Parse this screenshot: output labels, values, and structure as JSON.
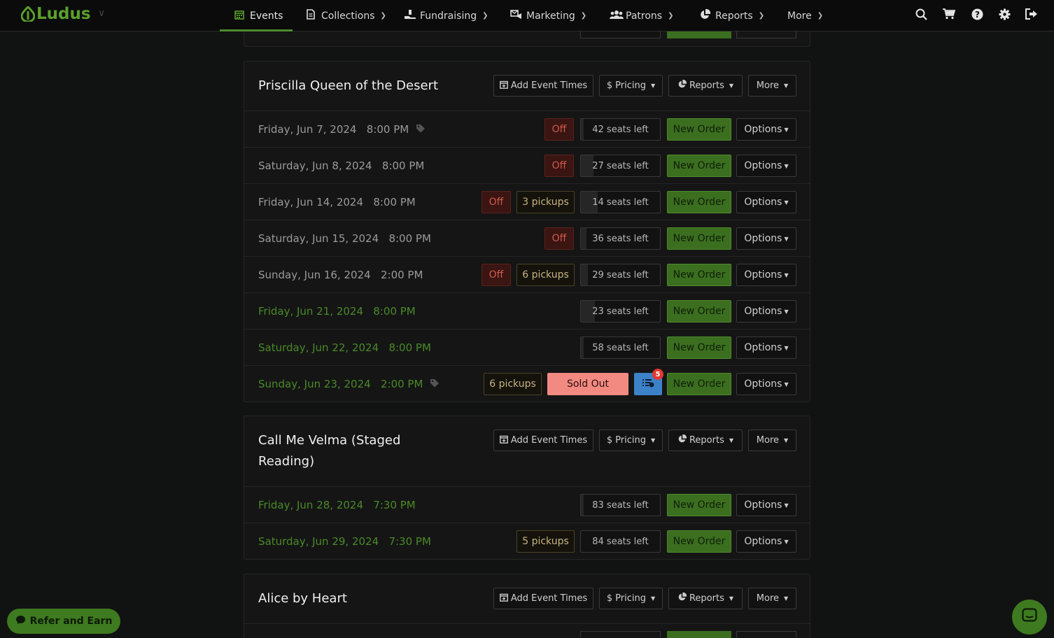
{
  "nav": {
    "logo": "Ludus",
    "items": [
      {
        "label": "Events",
        "icon": "calendar-icon"
      },
      {
        "label": "Collections",
        "icon": "document-icon"
      },
      {
        "label": "Fundraising",
        "icon": "donate-hand-icon"
      },
      {
        "label": "Marketing",
        "icon": "mail-bullhorn-icon"
      },
      {
        "label": "Patrons",
        "icon": "users-icon"
      },
      {
        "label": "Reports",
        "icon": "pie-chart-icon"
      },
      {
        "label": "More",
        "icon": ""
      }
    ],
    "right_icons": [
      "search-icon",
      "cart-icon",
      "help-icon",
      "gear-icon",
      "logout-icon"
    ]
  },
  "labels": {
    "add_event_times": "Add Event Times",
    "pricing": "Pricing",
    "reports": "Reports",
    "more": "More",
    "off": "Off",
    "new_order": "New Order",
    "options": "Options",
    "sold_out": "Sold Out"
  },
  "events": [
    {
      "title": "Priscilla Queen of the Desert",
      "performances": [
        {
          "date": "Friday, Jun 7, 2024",
          "time": "8:00 PM",
          "tag": true,
          "off": true,
          "pickups": "",
          "seats": "42 seats left",
          "past": true
        },
        {
          "date": "Saturday, Jun 8, 2024",
          "time": "8:00 PM",
          "tag": false,
          "off": true,
          "pickups": "",
          "seats": "27 seats left",
          "past": true
        },
        {
          "date": "Friday, Jun 14, 2024",
          "time": "8:00 PM",
          "tag": false,
          "off": true,
          "pickups": "3 pickups",
          "seats": "14 seats left",
          "past": true
        },
        {
          "date": "Saturday, Jun 15, 2024",
          "time": "8:00 PM",
          "tag": false,
          "off": true,
          "pickups": "",
          "seats": "36 seats left",
          "past": true
        },
        {
          "date": "Sunday, Jun 16, 2024",
          "time": "2:00 PM",
          "tag": false,
          "off": true,
          "pickups": "6 pickups",
          "seats": "29 seats left",
          "past": true
        },
        {
          "date": "Friday, Jun 21, 2024",
          "time": "8:00 PM",
          "tag": false,
          "off": false,
          "pickups": "",
          "seats": "23 seats left",
          "past": false
        },
        {
          "date": "Saturday, Jun 22, 2024",
          "time": "8:00 PM",
          "tag": false,
          "off": false,
          "pickups": "",
          "seats": "58 seats left",
          "past": false
        },
        {
          "date": "Sunday, Jun 23, 2024",
          "time": "2:00 PM",
          "tag": true,
          "off": false,
          "pickups": "6 pickups",
          "seats": "",
          "sold_out": true,
          "waitlist_count": "5",
          "past": false
        }
      ]
    },
    {
      "title_line1": "Call Me Velma (Staged",
      "title_line2": "Reading)",
      "performances": [
        {
          "date": "Friday, Jun 28, 2024",
          "time": "7:30 PM",
          "off": false,
          "pickups": "",
          "seats": "83 seats left"
        },
        {
          "date": "Saturday, Jun 29, 2024",
          "time": "7:30 PM",
          "off": false,
          "pickups": "5 pickups",
          "seats": "84 seats left"
        }
      ]
    },
    {
      "title": "Alice by Heart"
    }
  ],
  "footer": {
    "refer": "Refer and Earn"
  },
  "colors": {
    "brand_green": "#5aa02c",
    "new_order_green": "#3b6e1f",
    "sold_out": "#f28a82",
    "waitlist_blue": "#3b82c9"
  }
}
